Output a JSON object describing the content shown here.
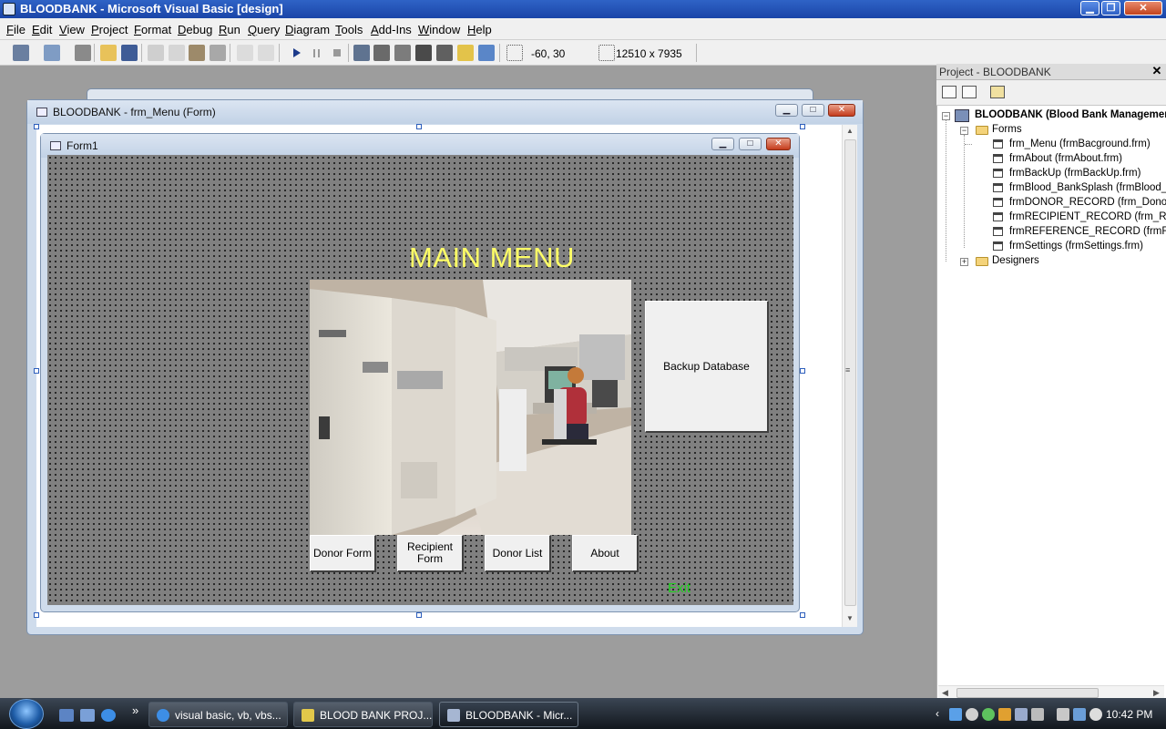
{
  "window": {
    "title": "BLOODBANK - Microsoft Visual Basic [design]"
  },
  "menubar": {
    "items": [
      "File",
      "Edit",
      "View",
      "Project",
      "Format",
      "Debug",
      "Run",
      "Query",
      "Diagram",
      "Tools",
      "Add-Ins",
      "Window",
      "Help"
    ]
  },
  "toolbar": {
    "position_readout": "-60, 30",
    "size_readout": "12510 x 7935",
    "icons": [
      "add-project-icon",
      "add-form-icon",
      "menu-editor-icon",
      "open-icon",
      "save-icon",
      "cut-icon",
      "copy-icon",
      "paste-icon",
      "find-icon",
      "undo-icon",
      "redo-icon",
      "run-icon",
      "pause-icon",
      "stop-icon",
      "project-explorer-icon",
      "properties-icon",
      "form-layout-icon",
      "object-browser-icon",
      "toolbox-icon",
      "data-view-icon",
      "component-manager-icon"
    ]
  },
  "designer": {
    "outer_title": "BLOODBANK - frm_Menu (Form)",
    "inner_title": "Form1",
    "heading": "MAIN MENU",
    "backup_button": "Backup Database",
    "buttons": {
      "donor_form": "Donor Form",
      "recipient_line1": "Recipient",
      "recipient_line2": "Form",
      "donor_list": "Donor List",
      "about": "About"
    },
    "exit_label": "Exit"
  },
  "project_explorer": {
    "title": "Project - BLOODBANK",
    "root": "BLOODBANK (Blood Bank Management",
    "forms_folder": "Forms",
    "forms": [
      "frm_Menu (frmBacground.frm)",
      "frmAbout (frmAbout.frm)",
      "frmBackUp (frmBackUp.frm)",
      "frmBlood_BankSplash (frmBlood_Ba",
      "frmDONOR_RECORD (frm_Donor.fr",
      "frmRECIPIENT_RECORD (frm_Recip",
      "frmREFERENCE_RECORD (frmRefer",
      "frmSettings (frmSettings.frm)"
    ],
    "designers_folder": "Designers"
  },
  "taskbar": {
    "tasks": [
      {
        "label": "visual basic, vb, vbs...",
        "icon": "ie-icon"
      },
      {
        "label": "BLOOD BANK PROJ...",
        "icon": "document-icon"
      },
      {
        "label": "BLOODBANK - Micr...",
        "icon": "vb6-icon"
      }
    ],
    "clock": "10:42 PM",
    "quicklaunch_chevron": "»"
  },
  "colors": {
    "heading_yellow": "#ffff66",
    "exit_green": "#1fcf1f",
    "form_background": "#808080"
  }
}
